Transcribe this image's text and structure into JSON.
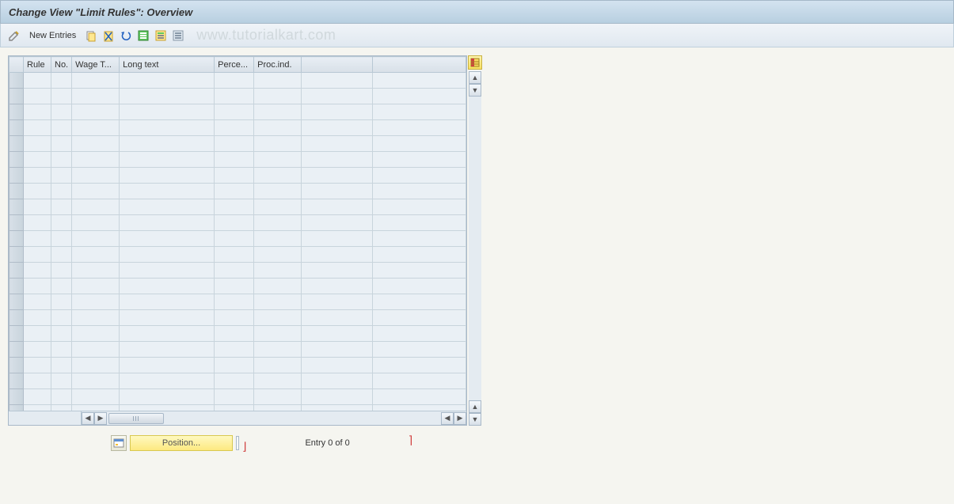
{
  "header": {
    "title": "Change View \"Limit Rules\": Overview"
  },
  "toolbar": {
    "new_entries_label": "New Entries",
    "icons": {
      "pencil": "change-icon",
      "copy": "copy-icon",
      "delete": "delete-icon",
      "undo": "undo-icon",
      "select_all": "select-all-icon",
      "select_block": "select-block-icon",
      "deselect": "deselect-icon"
    },
    "watermark": "www.tutorialkart.com"
  },
  "table": {
    "columns": [
      "Rule",
      "No.",
      "Wage T...",
      "Long text",
      "Perce...",
      "Proc.ind.",
      ""
    ],
    "row_count": 22,
    "config_icon": "table-settings-icon"
  },
  "footer": {
    "position_label": "Position...",
    "entry_label": "Entry 0 of 0"
  }
}
